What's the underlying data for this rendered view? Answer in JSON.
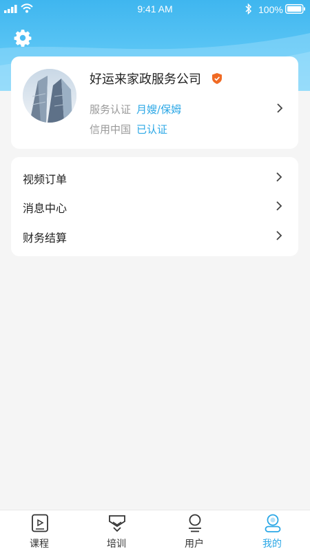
{
  "status_bar": {
    "time": "9:41 AM",
    "battery": "100%"
  },
  "profile": {
    "company_name": "好运来家政服务公司",
    "service_cert_label": "服务认证",
    "service_cert_value": "月嫂/保姆",
    "credit_label": "信用中国",
    "credit_value": "已认证"
  },
  "menu": [
    {
      "label": "视频订单"
    },
    {
      "label": "消息中心"
    },
    {
      "label": "财务结算"
    }
  ],
  "tabs": [
    {
      "label": "课程",
      "icon": "course-icon"
    },
    {
      "label": "培训",
      "icon": "training-icon"
    },
    {
      "label": "用户",
      "icon": "user-icon"
    },
    {
      "label": "我的",
      "icon": "mine-icon"
    }
  ],
  "colors": {
    "accent": "#2aa7e6",
    "header": "#4cbcf2",
    "badge": "#f06a24"
  }
}
